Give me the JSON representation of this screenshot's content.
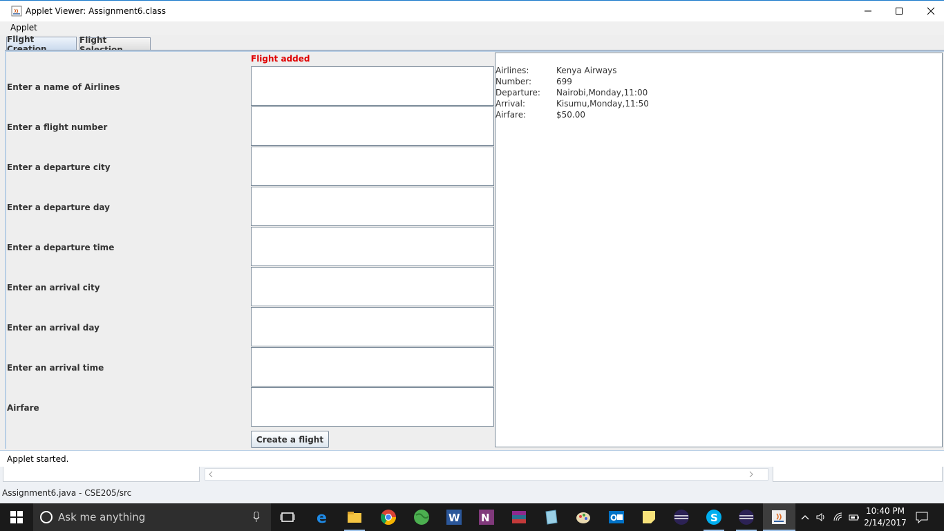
{
  "window": {
    "title": "Applet Viewer: Assignment6.class"
  },
  "menu": {
    "items": [
      "Applet"
    ]
  },
  "tabs": [
    {
      "label": "Flight Creation",
      "active": true
    },
    {
      "label": "Flight Selection",
      "active": false
    }
  ],
  "form": {
    "status_message": "Flight added",
    "fields": [
      {
        "label": "Enter a name of Airlines",
        "value": ""
      },
      {
        "label": "Enter a flight number",
        "value": ""
      },
      {
        "label": "Enter a departure city",
        "value": ""
      },
      {
        "label": "Enter a departure day",
        "value": ""
      },
      {
        "label": "Enter a departure time",
        "value": ""
      },
      {
        "label": "Enter an arrival city",
        "value": ""
      },
      {
        "label": "Enter an arrival day",
        "value": ""
      },
      {
        "label": "Enter an arrival time",
        "value": ""
      },
      {
        "label": "Airfare",
        "value": ""
      }
    ],
    "submit_label": "Create a flight"
  },
  "flight_info": [
    {
      "key": "Airlines:",
      "value": "Kenya Airways"
    },
    {
      "key": "Number:",
      "value": "699"
    },
    {
      "key": "Departure:",
      "value": "Nairobi,Monday,11:00"
    },
    {
      "key": "Arrival:",
      "value": "Kisumu,Monday,11:50"
    },
    {
      "key": "Airfare:",
      "value": "$50.00"
    }
  ],
  "applet_status": "Applet started.",
  "eclipse_status": "Assignment6.java - CSE205/src",
  "taskbar": {
    "search_placeholder": "Ask me anything",
    "time": "10:40 PM",
    "date": "2/14/2017",
    "apps": [
      "task-view-icon",
      "edge-icon",
      "file-explorer-icon",
      "chrome-icon",
      "globe-icon",
      "word-icon",
      "onenote-icon",
      "winrar-icon",
      "notepad-icon",
      "paint-icon",
      "outlook-icon",
      "sticky-notes-icon",
      "eclipse-icon",
      "skype-icon",
      "eclipse-icon",
      "java-icon"
    ]
  },
  "colors": {
    "status_message": "#e00000",
    "tab_active": "#c7d8ec",
    "taskbar": "#1a1a1a"
  }
}
